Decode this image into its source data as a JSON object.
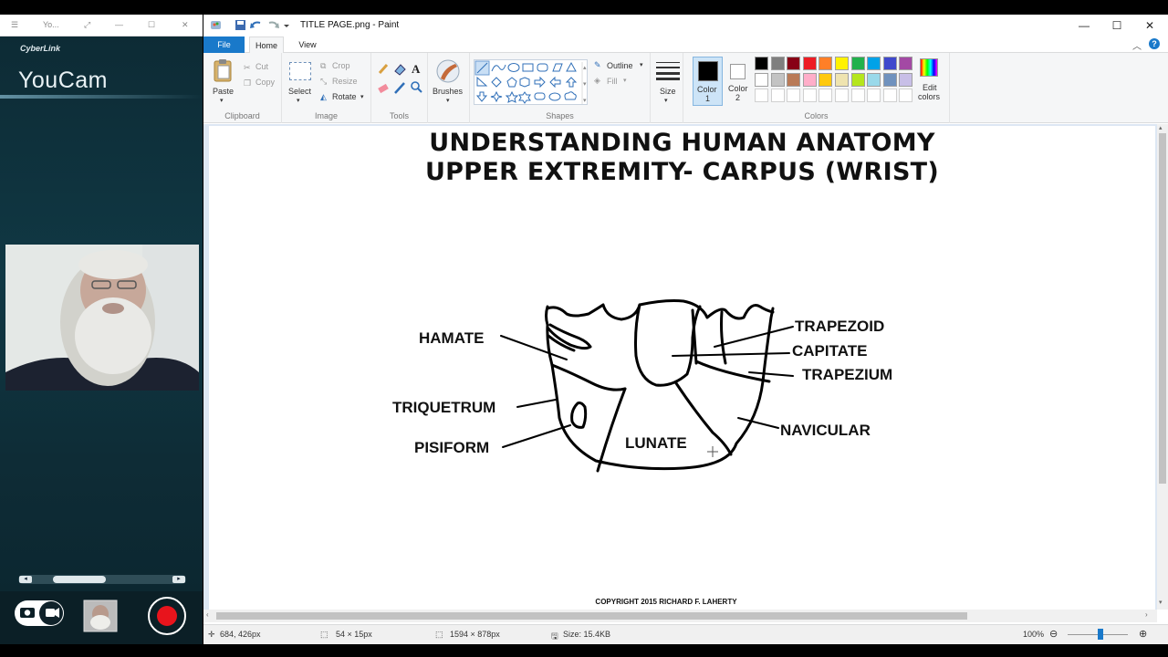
{
  "youcam": {
    "titlebar_text": "Yo...",
    "brand": "CyberLink",
    "app_name": "YouCam"
  },
  "paint": {
    "window_title": "TITLE PAGE.png - Paint",
    "tabs": {
      "file": "File",
      "home": "Home",
      "view": "View"
    },
    "clipboard": {
      "paste": "Paste",
      "cut": "Cut",
      "copy": "Copy",
      "group": "Clipboard"
    },
    "image": {
      "select": "Select",
      "crop": "Crop",
      "resize": "Resize",
      "rotate": "Rotate",
      "group": "Image"
    },
    "tools": {
      "group": "Tools"
    },
    "brushes": {
      "label": "Brushes"
    },
    "shapes": {
      "outline": "Outline",
      "fill": "Fill",
      "group": "Shapes"
    },
    "size": {
      "label": "Size"
    },
    "color1": {
      "label": "Color",
      "num": "1"
    },
    "color2": {
      "label": "Color",
      "num": "2"
    },
    "colors": {
      "group": "Colors",
      "edit_label": "Edit",
      "edit_label2": "colors",
      "row1": [
        "#000000",
        "#7f7f7f",
        "#880015",
        "#ed1c24",
        "#ff7f27",
        "#fff200",
        "#22b14c",
        "#00a2e8",
        "#3f48cc",
        "#a349a4"
      ],
      "row2": [
        "#ffffff",
        "#c3c3c3",
        "#b97a57",
        "#ffaec9",
        "#ffc90e",
        "#efe4b0",
        "#b5e61d",
        "#99d9ea",
        "#7092be",
        "#c8bfe7"
      ]
    },
    "document": {
      "title_line1": "UNDERSTANDING HUMAN ANATOMY",
      "title_line2": "UPPER EXTREMITY- CARPUS (WRIST)",
      "labels": {
        "hamate": "HAMATE",
        "triquetrum": "TRIQUETRUM",
        "pisiform": "PISIFORM",
        "lunate": "LUNATE",
        "trapezoid": "TRAPEZOID",
        "capitate": "CAPITATE",
        "trapezium": "TRAPEZIUM",
        "navicular": "NAVICULAR"
      },
      "copyright": "COPYRIGHT 2015 RICHARD F. LAHERTY"
    },
    "status": {
      "cursor_pos": "684, 426px",
      "selection_size": "54 × 15px",
      "image_size": "1594 × 878px",
      "file_size": "Size: 15.4KB",
      "zoom": "100%"
    }
  }
}
